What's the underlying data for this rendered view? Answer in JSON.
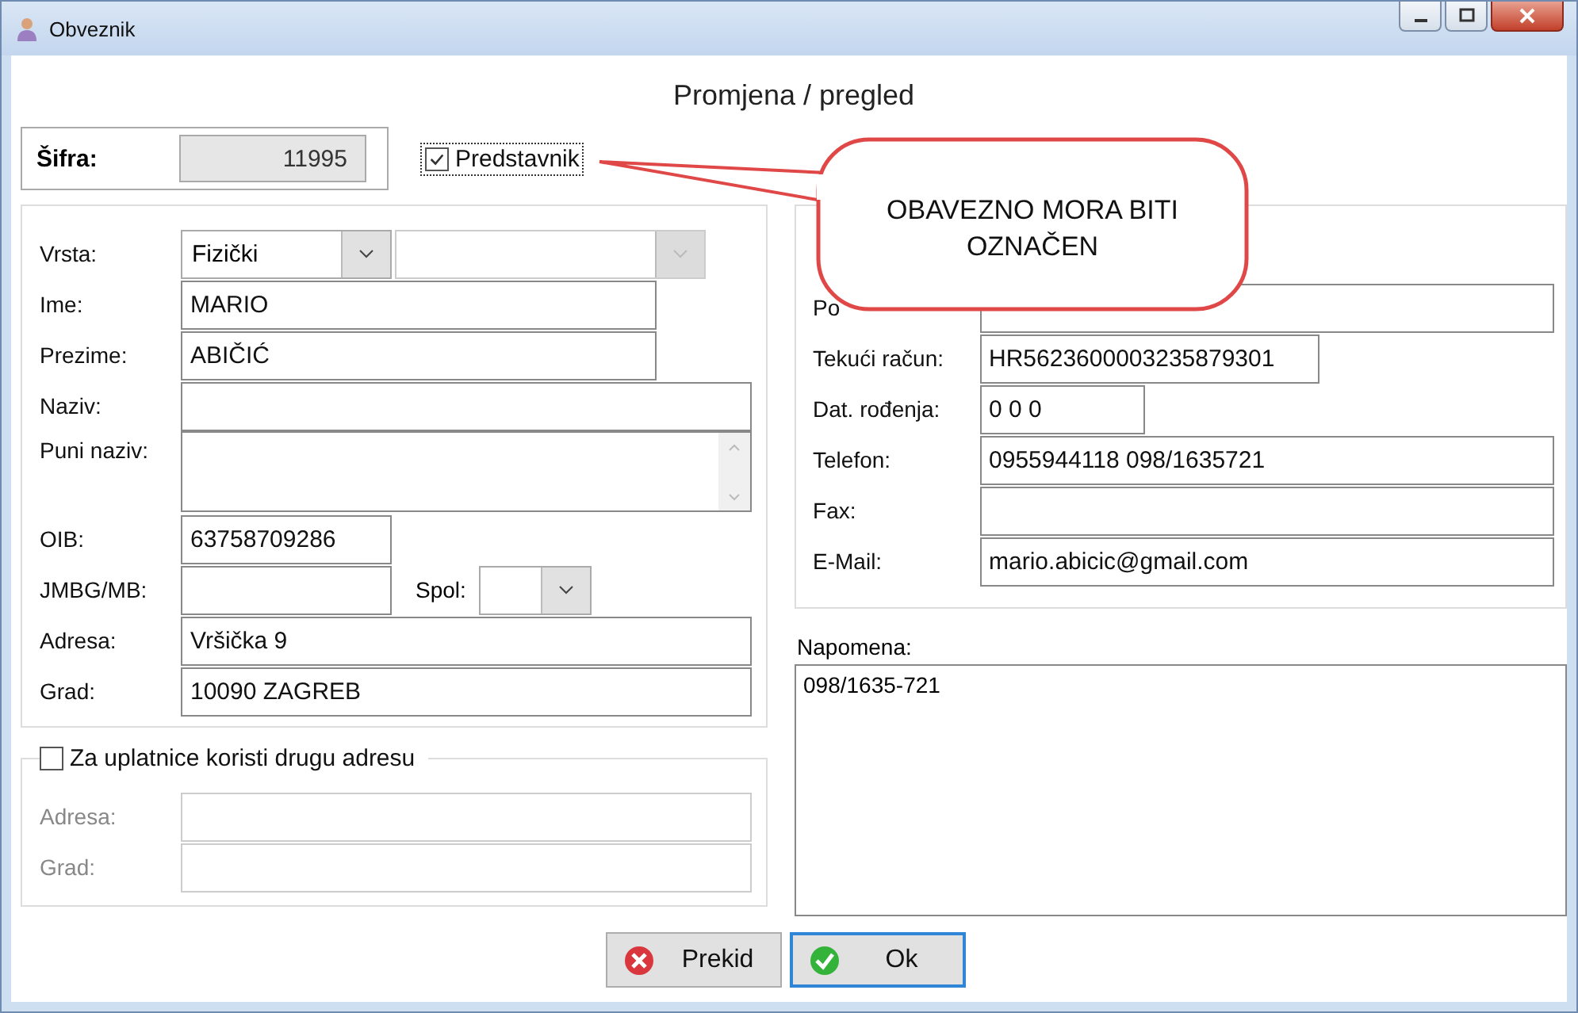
{
  "window": {
    "title": "Obveznik"
  },
  "heading": "Promjena / pregled",
  "code": {
    "label": "Šifra:",
    "value": "11995"
  },
  "representative": {
    "label": "Predstavnik",
    "checked": true,
    "focused": true
  },
  "person_fields": [
    {
      "kind": "combo_pair",
      "label": "Vrsta:",
      "value": "Fizički",
      "second_disabled": true
    },
    {
      "kind": "text",
      "label": "Ime:",
      "value": "MARIO"
    },
    {
      "kind": "text",
      "label": "Prezime:",
      "value": "ABIČIĆ"
    },
    {
      "kind": "text",
      "label": "Naziv:"
    },
    {
      "kind": "textarea",
      "label": "Puni naziv:"
    },
    {
      "kind": "text",
      "label": "OIB:",
      "value": "63758709286"
    },
    {
      "kind": "text_with_combo",
      "label": "JMBG/MB:",
      "combo_label": "Spol:"
    },
    {
      "kind": "text",
      "label": "Adresa:",
      "value": "Vršička 9"
    },
    {
      "kind": "text",
      "label": "Grad:",
      "value": "10090 ZAGREB"
    }
  ],
  "alternate_address": {
    "label": "Za uplatnice koristi drugu adresu",
    "checked": false,
    "disabled": true,
    "fields": [
      {
        "label": "Adresa:"
      },
      {
        "label": "Grad:"
      }
    ]
  },
  "contact_fields": [
    {
      "label": "Po"
    },
    {
      "label": "Tekući račun:",
      "value": "HR5623600003235879301"
    },
    {
      "label": "Dat. rođenja:",
      "value": "0 0  0"
    },
    {
      "label": "Telefon:",
      "value": "0955944118 098/1635721"
    },
    {
      "label": "Fax:"
    },
    {
      "label": "E-Mail:",
      "value": "mario.abicic@gmail.com"
    }
  ],
  "note": {
    "label": "Napomena:",
    "value": "098/1635-721"
  },
  "callout": {
    "text": "OBAVEZNO MORA BITI OZNAČEN"
  },
  "buttons": [
    {
      "kind": "cancel",
      "label": "Prekid",
      "focused": false
    },
    {
      "kind": "ok",
      "label": "Ok",
      "focused": true
    }
  ]
}
